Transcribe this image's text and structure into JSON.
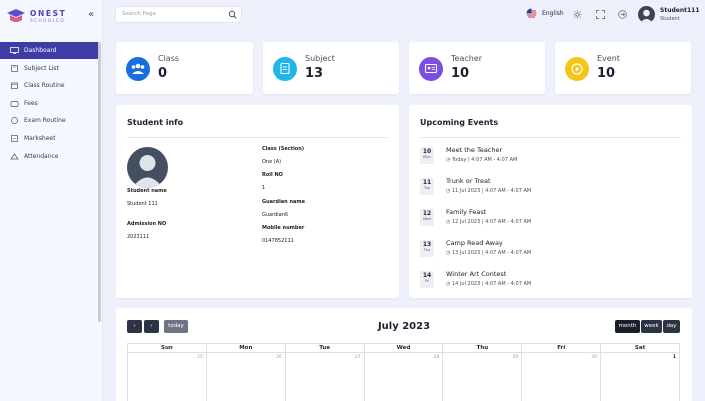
{
  "brand": {
    "name": "ONEST",
    "tagline": "SCHOOLED"
  },
  "sidebar": {
    "items": [
      {
        "label": "Dashboard",
        "icon": "monitor-icon",
        "active": true
      },
      {
        "label": "Subject List",
        "icon": "book-icon"
      },
      {
        "label": "Class Routine",
        "icon": "calendar-icon"
      },
      {
        "label": "Fees",
        "icon": "wallet-icon"
      },
      {
        "label": "Exam Routine",
        "icon": "exam-icon"
      },
      {
        "label": "Marksheet",
        "icon": "marksheet-icon"
      },
      {
        "label": "Attendance",
        "icon": "attendance-icon"
      }
    ]
  },
  "header": {
    "search_placeholder": "Search Page",
    "language": "English",
    "user": {
      "name": "Student111",
      "role": "Student"
    }
  },
  "stats": [
    {
      "label": "Class",
      "value": "0",
      "color": "#1a6de0",
      "icon": "class-icon"
    },
    {
      "label": "Subject",
      "value": "13",
      "color": "#1fb6e8",
      "icon": "subject-icon"
    },
    {
      "label": "Teacher",
      "value": "10",
      "color": "#7a4fe0",
      "icon": "teacher-icon"
    },
    {
      "label": "Event",
      "value": "10",
      "color": "#f5c518",
      "icon": "event-icon"
    }
  ],
  "student_info": {
    "title": "Student info",
    "left": [
      {
        "label": "Student name",
        "value": "Student 111"
      },
      {
        "label": "Admission NO",
        "value": "2023111"
      }
    ],
    "right": [
      {
        "label": "Class (Section)",
        "value": "One (A)"
      },
      {
        "label": "Roll NO",
        "value": "1"
      },
      {
        "label": "Guardian name",
        "value": "Guardian6"
      },
      {
        "label": "Mobile number",
        "value": "0147852111"
      }
    ]
  },
  "events": {
    "title": "Upcoming Events",
    "items": [
      {
        "day": "10",
        "mon": "Mon",
        "title": "Meet the Teacher",
        "meta": "Today | 4:07 AM - 4:07 AM"
      },
      {
        "day": "11",
        "mon": "Tue",
        "title": "Trunk or Treat",
        "meta": "11 Jul 2023 | 4:07 AM - 4:07 AM"
      },
      {
        "day": "12",
        "mon": "Wed",
        "title": "Family Feast",
        "meta": "12 Jul 2023 | 4:07 AM - 4:07 AM"
      },
      {
        "day": "13",
        "mon": "Thu",
        "title": "Camp Read Away",
        "meta": "13 Jul 2023 | 4:07 AM - 4:07 AM"
      },
      {
        "day": "14",
        "mon": "Fri",
        "title": "Winter Art Contest",
        "meta": "14 Jul 2023 | 4:07 AM - 4:07 AM"
      }
    ]
  },
  "calendar": {
    "title": "July 2023",
    "today_label": "today",
    "prev_label": "‹",
    "next_label": "›",
    "views": [
      "month",
      "week",
      "day"
    ],
    "active_view": "month",
    "weekdays": [
      "Sun",
      "Mon",
      "Tue",
      "Wed",
      "Thu",
      "Fri",
      "Sat"
    ],
    "first_row": [
      "25",
      "26",
      "27",
      "28",
      "29",
      "30",
      "1"
    ]
  }
}
